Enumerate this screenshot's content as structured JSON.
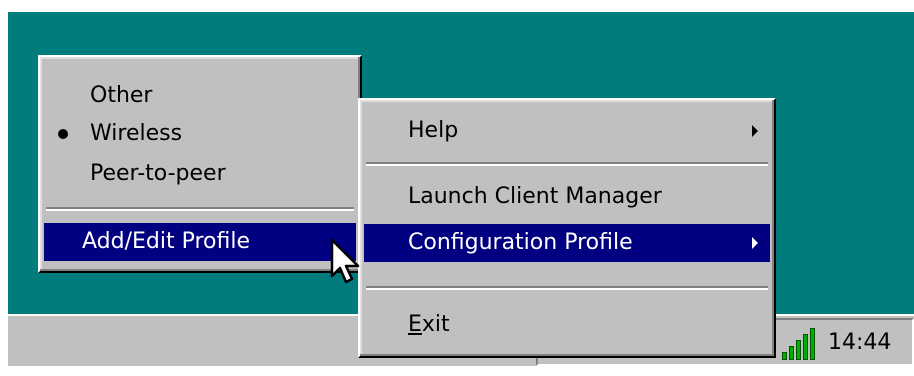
{
  "left_menu": {
    "items": [
      {
        "label": "Other",
        "checked": false
      },
      {
        "label": "Wireless",
        "checked": true
      },
      {
        "label": "Peer-to-peer",
        "checked": false
      }
    ],
    "selected_item": {
      "label": "Add/Edit Profile"
    }
  },
  "context_menu": {
    "help": {
      "label": "Help",
      "has_submenu": true
    },
    "launch": {
      "label": "Launch Client Manager"
    },
    "config": {
      "label": "Configuration Profile",
      "has_submenu": true
    },
    "exit": {
      "label": "Exit",
      "mnemonic": "E",
      "rest": "xit"
    }
  },
  "tray": {
    "clock": "14:44"
  },
  "colors": {
    "desktop": "#007c7c",
    "menu_face": "#c0c0c0",
    "highlight": "#000080",
    "signal": "#00b000"
  }
}
